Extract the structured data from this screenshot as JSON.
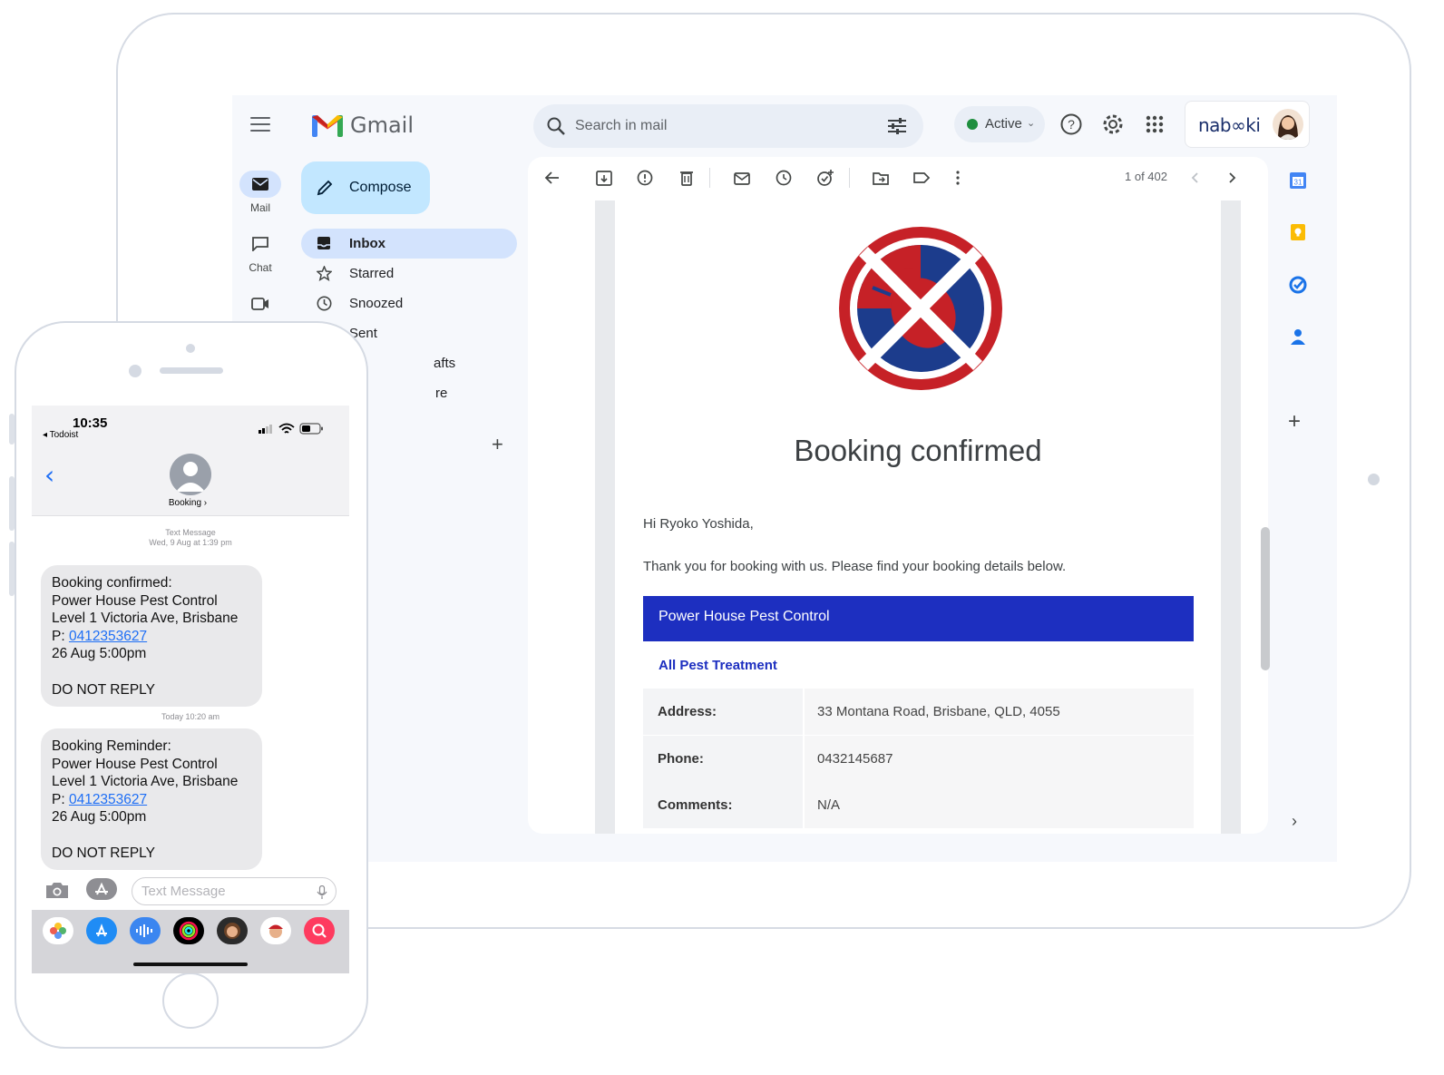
{
  "gmail": {
    "app_name": "Gmail",
    "search_placeholder": "Search in mail",
    "status": "Active",
    "brand": "nab∞ki",
    "rail": [
      {
        "label": "Mail"
      },
      {
        "label": "Chat"
      },
      {
        "label": ""
      }
    ],
    "compose_label": "Compose",
    "nav": [
      {
        "label": "Inbox",
        "selected": true
      },
      {
        "label": "Starred"
      },
      {
        "label": "Snoozed"
      },
      {
        "label": "Sent"
      },
      {
        "label": "afts"
      },
      {
        "label": "re"
      }
    ],
    "pager": "1 of 402",
    "colors": {
      "accent": "#1d2fc0",
      "selected_nav": "#d3e3fd",
      "compose": "#c2e7ff",
      "logo_red": "#c62127",
      "logo_blue": "#1c3c8c"
    }
  },
  "email": {
    "heading": "Booking confirmed",
    "greeting": "Hi Ryoko Yoshida,",
    "intro": "Thank you for booking with us. Please find your booking details below.",
    "company": "Power House Pest Control",
    "service": "All Pest Treatment",
    "details": [
      {
        "key": "Address:",
        "value": "33 Montana Road, Brisbane, QLD, 4055"
      },
      {
        "key": "Phone:",
        "value": "0432145687"
      },
      {
        "key": "Comments:",
        "value": "N/A"
      }
    ]
  },
  "phone": {
    "time": "10:35",
    "back_app": "◂ Todoist",
    "contact": "Booking ›",
    "messages": [
      {
        "meta_type": "Text Message",
        "meta_time": "Wed, 9 Aug at 1:39 pm",
        "lines": [
          "Booking confirmed:",
          "Power House Pest Control",
          "Level 1 Victoria Ave, Brisbane"
        ],
        "phone_prefix": "P: ",
        "phone": "0412353627",
        "datetime": "26 Aug 5:00pm",
        "footer": "DO NOT REPLY"
      },
      {
        "meta_time": "Today 10:20 am",
        "lines": [
          "Booking Reminder:",
          "Power House Pest Control",
          "Level 1 Victoria Ave, Brisbane"
        ],
        "phone_prefix": "P: ",
        "phone": "0412353627",
        "datetime": "26 Aug 5:00pm",
        "footer": "DO NOT REPLY"
      }
    ],
    "input_placeholder": "Text Message",
    "colors": {
      "link": "#1f6ff5",
      "bubble": "#e9e9eb"
    }
  }
}
